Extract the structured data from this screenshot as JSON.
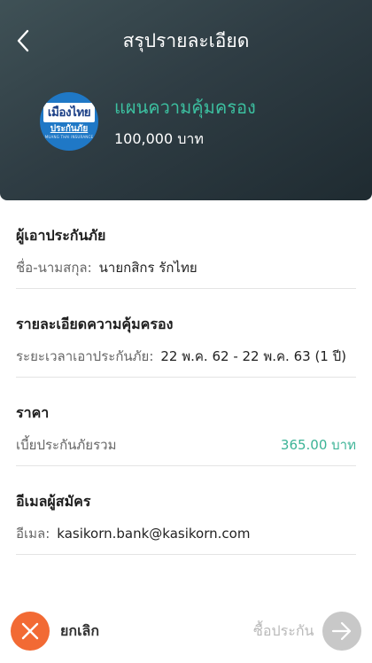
{
  "header": {
    "title": "สรุปรายละเอียด",
    "back_icon": "chevron-left-icon"
  },
  "plan": {
    "logo": {
      "line1": "เมืองไทย",
      "line2": "ประกันภัย",
      "line3": "MUANG THAI INSURANCE"
    },
    "name": "แผนความคุ้มครอง",
    "amount": "100,000 บาท"
  },
  "insured": {
    "title": "ผู้เอาประกันภัย",
    "name_label": "ชื่อ-นามสกุล:",
    "name_value": "นายกสิกร รักไทย"
  },
  "coverage": {
    "title": "รายละเอียดความคุ้มครอง",
    "period_label": "ระยะเวลาเอาประกันภัย:",
    "period_value": "22 พ.ค. 62 - 22 พ.ค. 63 (1 ปี)"
  },
  "price": {
    "title": "ราคา",
    "premium_label": "เบี้ยประกันภัยรวม",
    "premium_value": "365.00 บาท"
  },
  "applicant_email": {
    "title": "อีเมลผู้สมัคร",
    "email_label": "อีเมล:",
    "email_value": "kasikorn.bank@kasikorn.com"
  },
  "footer": {
    "cancel_label": "ยกเลิก",
    "buy_label": "ซื้อประกัน",
    "cancel_icon": "close-icon",
    "buy_icon": "arrow-right-icon"
  },
  "colors": {
    "accent_green": "#3cc0a0",
    "cancel_orange": "#f26a34",
    "disabled_gray": "#c8c8c8"
  }
}
